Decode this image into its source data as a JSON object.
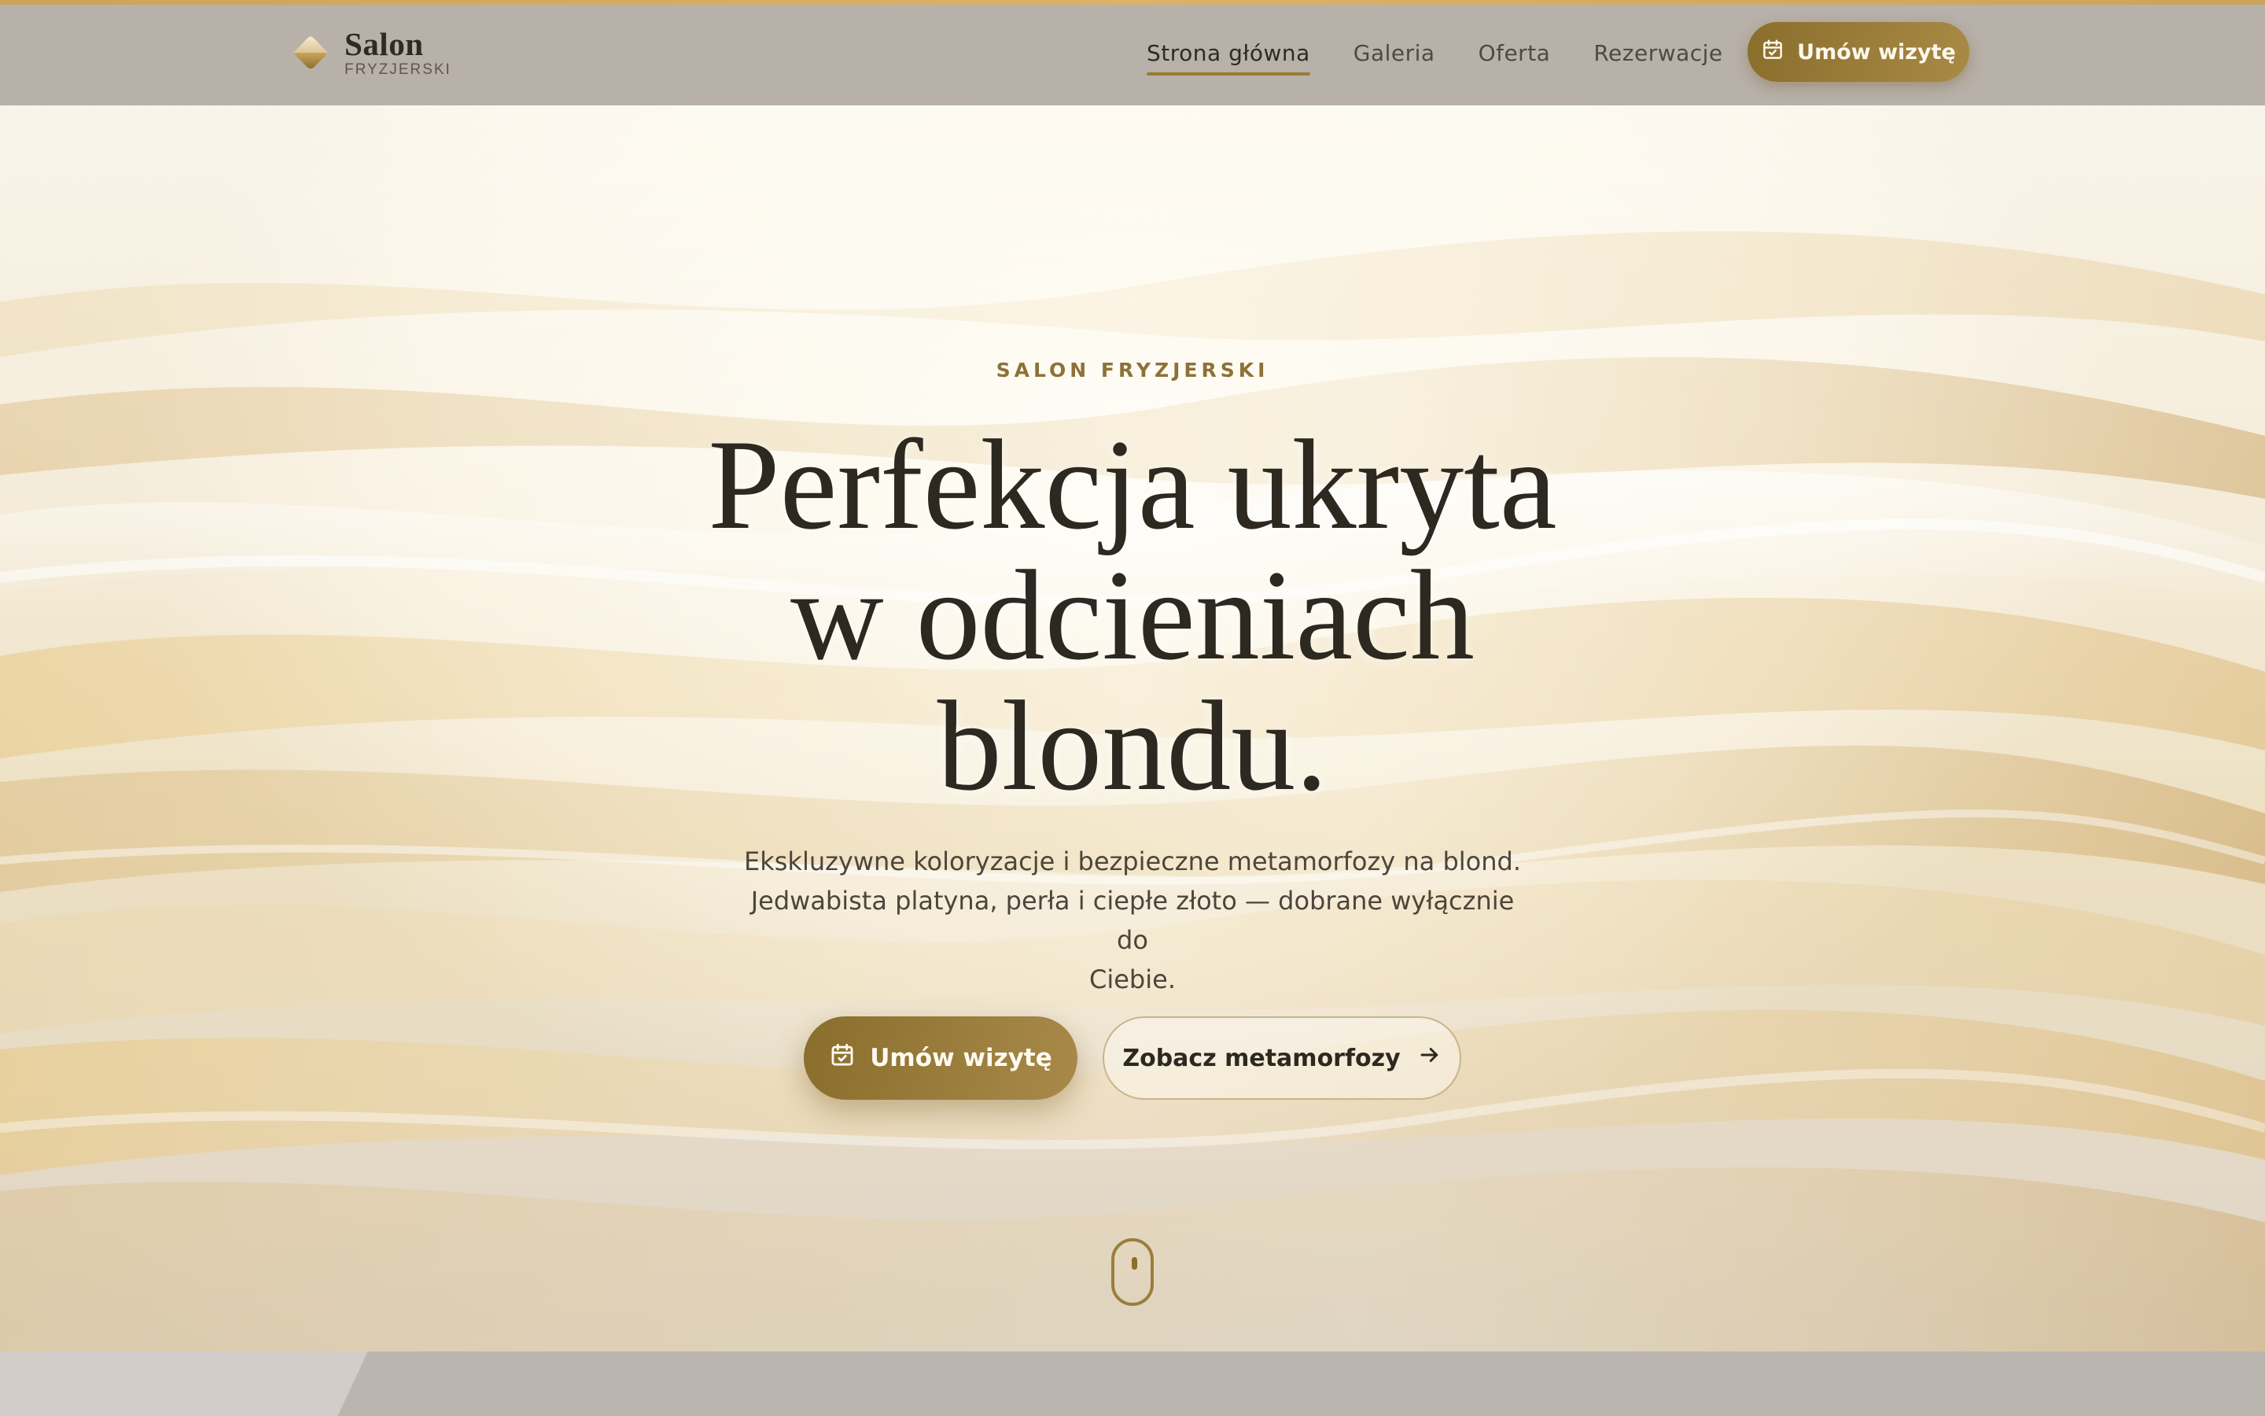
{
  "brand": {
    "name": "Salon",
    "subtitle": "FRYZJERSKI"
  },
  "nav": {
    "items": [
      {
        "label": "Strona główna",
        "active": true
      },
      {
        "label": "Galeria",
        "active": false
      },
      {
        "label": "Oferta",
        "active": false
      },
      {
        "label": "Rezerwacje",
        "active": false
      }
    ],
    "cta_label": "Umów wizytę",
    "cta_icon": "calendar-check-icon"
  },
  "hero": {
    "eyebrow": "SALON FRYZJERSKI",
    "headline_line1": "Perfekcja ukryta",
    "headline_line2": "w odcieniach",
    "headline_line3": "blondu.",
    "lead_line1": "Ekskluzywne koloryzacje i bezpieczne metamorfozy na blond.",
    "lead_line2": "Jedwabista platyna, perła i ciepłe złoto — dobrane wyłącznie do",
    "lead_line3": "Ciebie.",
    "primary_button": "Umów wizytę",
    "secondary_button": "Zobacz metamorfozy",
    "scroll_indicator_icon": "mouse-scroll-icon"
  },
  "colors": {
    "accent_gold": "#9a7b34",
    "button_gold": "#8a6e2c",
    "header_bg": "#b8b1aa",
    "text_dark": "#2d2820"
  }
}
